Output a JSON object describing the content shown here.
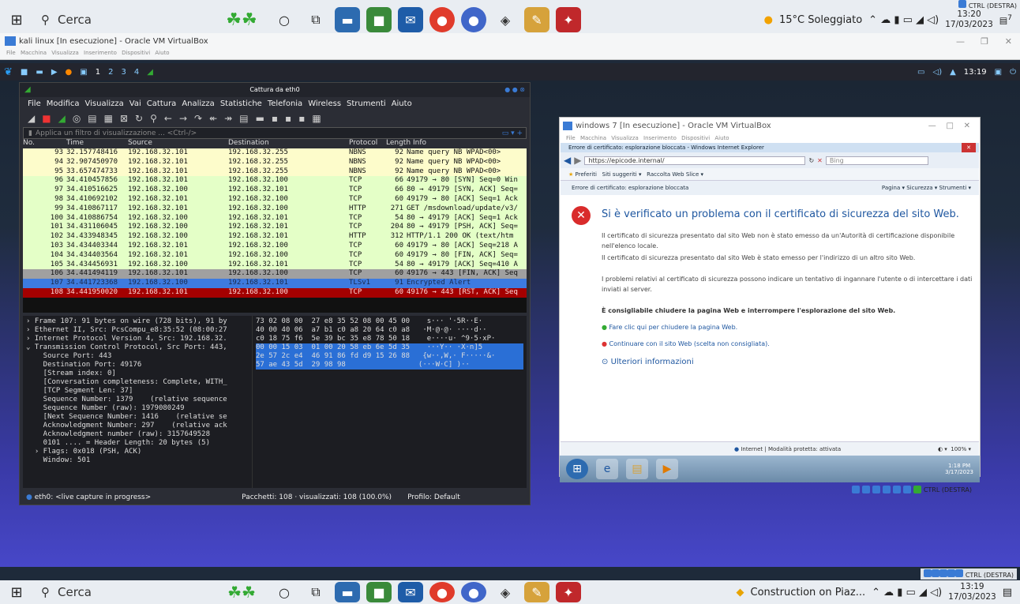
{
  "host_taskbar_top": {
    "search_label": "Cerca",
    "weather": "15°C Soleggiato",
    "time": "13:20",
    "date": "17/03/2023",
    "notif_count": "7",
    "vm_hint": "CTRL (DESTRA)"
  },
  "host_taskbar_bottom": {
    "search_label": "Cerca",
    "news": "Construction on Piaz...",
    "time": "13:19",
    "date": "17/03/2023",
    "vm_hint": "CTRL (DESTRA)"
  },
  "kali_vm": {
    "title": "kali linux [In esecuzione] - Oracle VM VirtualBox",
    "menu": "File  Macchina  Visualizza  Inserimento  Dispositivi  Aiuto",
    "workspaces": [
      "1",
      "2",
      "3",
      "4"
    ],
    "clock": "13:19"
  },
  "wireshark": {
    "title": "Cattura da eth0",
    "menu": [
      "File",
      "Modifica",
      "Visualizza",
      "Vai",
      "Cattura",
      "Analizza",
      "Statistiche",
      "Telefonia",
      "Wireless",
      "Strumenti",
      "Aiuto"
    ],
    "filter_placeholder": "Applica un filtro di visualizzazione ... <Ctrl-/>",
    "columns": [
      "No.",
      "Time",
      "Source",
      "Destination",
      "Protocol",
      "Length",
      "Info"
    ],
    "packets": [
      {
        "no": "93",
        "time": "32.157748416",
        "src": "192.168.32.101",
        "dst": "192.168.32.255",
        "proto": "NBNS",
        "len": "92",
        "info": "Name query NB WPAD<00>",
        "bg": "#fdfccb"
      },
      {
        "no": "94",
        "time": "32.907450970",
        "src": "192.168.32.101",
        "dst": "192.168.32.255",
        "proto": "NBNS",
        "len": "92",
        "info": "Name query NB WPAD<00>",
        "bg": "#fdfccb"
      },
      {
        "no": "95",
        "time": "33.657474733",
        "src": "192.168.32.101",
        "dst": "192.168.32.255",
        "proto": "NBNS",
        "len": "92",
        "info": "Name query NB WPAD<00>",
        "bg": "#fdfccb"
      },
      {
        "no": "96",
        "time": "34.410457856",
        "src": "192.168.32.101",
        "dst": "192.168.32.100",
        "proto": "TCP",
        "len": "66",
        "info": "49179 → 80 [SYN] Seq=0 Win",
        "bg": "#e4ffc7"
      },
      {
        "no": "97",
        "time": "34.410516625",
        "src": "192.168.32.100",
        "dst": "192.168.32.101",
        "proto": "TCP",
        "len": "66",
        "info": "80 → 49179 [SYN, ACK] Seq=",
        "bg": "#e4ffc7"
      },
      {
        "no": "98",
        "time": "34.410692102",
        "src": "192.168.32.101",
        "dst": "192.168.32.100",
        "proto": "TCP",
        "len": "60",
        "info": "49179 → 80 [ACK] Seq=1 Ack",
        "bg": "#e4ffc7"
      },
      {
        "no": "99",
        "time": "34.410867117",
        "src": "192.168.32.101",
        "dst": "192.168.32.100",
        "proto": "HTTP",
        "len": "271",
        "info": "GET /msdownload/update/v3/",
        "bg": "#e4ffc7"
      },
      {
        "no": "100",
        "time": "34.410886754",
        "src": "192.168.32.100",
        "dst": "192.168.32.101",
        "proto": "TCP",
        "len": "54",
        "info": "80 → 49179 [ACK] Seq=1 Ack",
        "bg": "#e4ffc7"
      },
      {
        "no": "101",
        "time": "34.431106045",
        "src": "192.168.32.100",
        "dst": "192.168.32.101",
        "proto": "TCP",
        "len": "204",
        "info": "80 → 49179 [PSH, ACK] Seq=",
        "bg": "#e4ffc7"
      },
      {
        "no": "102",
        "time": "34.433948345",
        "src": "192.168.32.100",
        "dst": "192.168.32.101",
        "proto": "HTTP",
        "len": "312",
        "info": "HTTP/1.1 200 OK  (text/htm",
        "bg": "#e4ffc7"
      },
      {
        "no": "103",
        "time": "34.434403344",
        "src": "192.168.32.101",
        "dst": "192.168.32.100",
        "proto": "TCP",
        "len": "60",
        "info": "49179 → 80 [ACK] Seq=218 A",
        "bg": "#e4ffc7"
      },
      {
        "no": "104",
        "time": "34.434403564",
        "src": "192.168.32.101",
        "dst": "192.168.32.100",
        "proto": "TCP",
        "len": "60",
        "info": "49179 → 80 [FIN, ACK] Seq=",
        "bg": "#e4ffc7"
      },
      {
        "no": "105",
        "time": "34.434456931",
        "src": "192.168.32.100",
        "dst": "192.168.32.101",
        "proto": "TCP",
        "len": "54",
        "info": "80 → 49179 [ACK] Seq=410 A",
        "bg": "#e4ffc7"
      },
      {
        "no": "106",
        "time": "34.441494119",
        "src": "192.168.32.101",
        "dst": "192.168.32.100",
        "proto": "TCP",
        "len": "60",
        "info": "49176 → 443 [FIN, ACK] Seq",
        "bg": "#a0a0a0"
      },
      {
        "no": "107",
        "time": "34.441723368",
        "src": "192.168.32.100",
        "dst": "192.168.32.101",
        "proto": "TLSv1",
        "len": "91",
        "info": "Encrypted Alert",
        "bg": "#3d7be0",
        "fg": "#1a2a4a"
      },
      {
        "no": "108",
        "time": "34.441950020",
        "src": "192.168.32.101",
        "dst": "192.168.32.100",
        "proto": "TCP",
        "len": "60",
        "info": "49176 → 443 [RST, ACK] Seq",
        "bg": "#a40000",
        "fg": "#ffdddd"
      }
    ],
    "details": [
      "› Frame 107: 91 bytes on wire (728 bits), 91 by",
      "› Ethernet II, Src: PcsCompu_e8:35:52 (08:00:27",
      "› Internet Protocol Version 4, Src: 192.168.32.",
      "⌄ Transmission Control Protocol, Src Port: 443,",
      "    Source Port: 443",
      "    Destination Port: 49176",
      "    [Stream index: 0]",
      "    [Conversation completeness: Complete, WITH_",
      "    [TCP Segment Len: 37]",
      "    Sequence Number: 1379    (relative sequence",
      "    Sequence Number (raw): 1979080249",
      "    [Next Sequence Number: 1416    (relative se",
      "    Acknowledgment Number: 297    (relative ack",
      "    Acknowledgment number (raw): 3157649528",
      "    0101 .... = Header Length: 20 bytes (5)",
      "  › Flags: 0x018 (PSH, ACK)",
      "    Window: 501"
    ],
    "hex": [
      "73 02 08 00  27 e8 35 52 08 00 45 00    s··· '·5R··E·",
      "40 00 40 06  a7 b1 c0 a8 20 64 c0 a8   ·M·@·@· ····d··",
      "c0 18 75 f6  5e 39 bc 35 e8 78 50 18    e····u· ^9·5·xP·",
      "00 00 15 03  01 00 20 58 eb 6e 5d 35    ···Y·· ·X·n]5",
      "2e 57 2c e4  46 91 86 fd d9 15 26 88   {w··,W,· F·····&·",
      "57 ae 43 5d  29 98 98                 (···W·C] )··"
    ],
    "status_capture": "eth0: <live capture in progress>",
    "status_packets": "Pacchetti: 108 · visualizzati: 108 (100.0%)",
    "status_profile": "Profilo: Default"
  },
  "win7_vm": {
    "title": "windows 7 [In esecuzione] - Oracle VM VirtualBox",
    "menu": "File  Macchina  Visualizza  Inserimento  Dispositivi  Aiuto",
    "ie_title": "Errore di certificato: esplorazione bloccata - Windows Internet Explorer",
    "url": "https://epicode.internal/",
    "search_placeholder": "Bing",
    "favorites": "Preferiti",
    "fav_1": "Siti suggeriti ▾",
    "fav_2": "Raccolta Web Slice ▾",
    "tab_label": "Errore di certificato: esplorazione bloccata",
    "ie_tools": "Pagina ▾  Sicurezza ▾  Strumenti ▾",
    "cert_title": "Si è verificato un problema con il certificato di sicurezza del sito Web.",
    "para1": "Il certificato di sicurezza presentato dal sito Web non è stato emesso da un'Autorità di certificazione disponibile nell'elenco locale.",
    "para2": "Il certificato di sicurezza presentato dal sito Web è stato emesso per l'indirizzo di un altro sito Web.",
    "para3": "I problemi relativi al certificato di sicurezza possono indicare un tentativo di ingannare l'utente o di intercettare i dati inviati al server.",
    "advice": "È consigliabile chiudere la pagina Web e interrompere l'esplorazione del sito Web.",
    "link_close": "Fare clic qui per chiudere la pagina Web.",
    "link_continue": "Continuare con il sito Web (scelta non consigliata).",
    "link_more": "Ulteriori informazioni",
    "status_zone": "Internet | Modalità protetta: attivata",
    "zoom": "100%",
    "clock_time": "1:18 PM",
    "clock_date": "3/17/2023",
    "vm_hint": "CTRL (DESTRA)"
  }
}
